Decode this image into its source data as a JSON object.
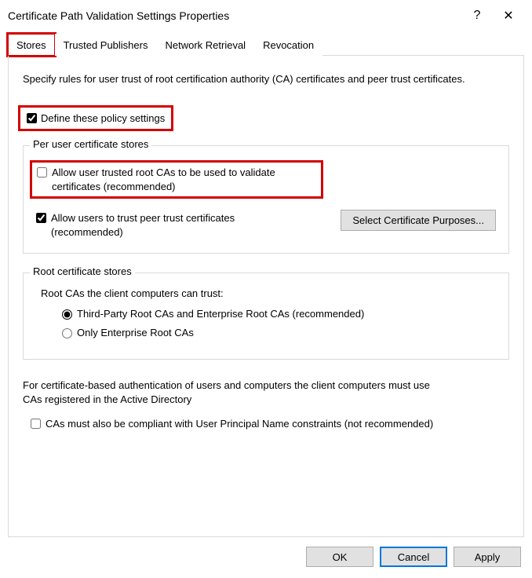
{
  "window": {
    "title": "Certificate Path Validation Settings Properties",
    "help_glyph": "?",
    "close_glyph": "✕"
  },
  "tabs": {
    "items": [
      {
        "label": "Stores",
        "active": true
      },
      {
        "label": "Trusted Publishers",
        "active": false
      },
      {
        "label": "Network Retrieval",
        "active": false
      },
      {
        "label": "Revocation",
        "active": false
      }
    ]
  },
  "content": {
    "description": "Specify rules for user trust of root certification authority (CA) certificates and peer trust certificates.",
    "define_label": "Define these policy settings",
    "define_checked": true,
    "group_user": {
      "legend": "Per user certificate stores",
      "allow_root_label": "Allow user trusted root CAs to be used to validate certificates (recommended)",
      "allow_root_checked": false,
      "allow_peer_label": "Allow users to trust peer trust certificates (recommended)",
      "allow_peer_checked": true,
      "select_purposes_label": "Select Certificate Purposes..."
    },
    "group_root": {
      "legend": "Root certificate stores",
      "subhead": "Root CAs the client computers can trust:",
      "radio_thirdparty": "Third-Party Root CAs and Enterprise Root CAs (recommended)",
      "radio_enterprise": "Only Enterprise Root CAs",
      "selected": "thirdparty"
    },
    "auth_text": "For certificate-based authentication of users and computers the client computers must use CAs registered in the Active Directory",
    "upn_label": "CAs must also be compliant with User Principal Name constraints (not recommended)",
    "upn_checked": false
  },
  "buttons": {
    "ok": "OK",
    "cancel": "Cancel",
    "apply": "Apply"
  }
}
